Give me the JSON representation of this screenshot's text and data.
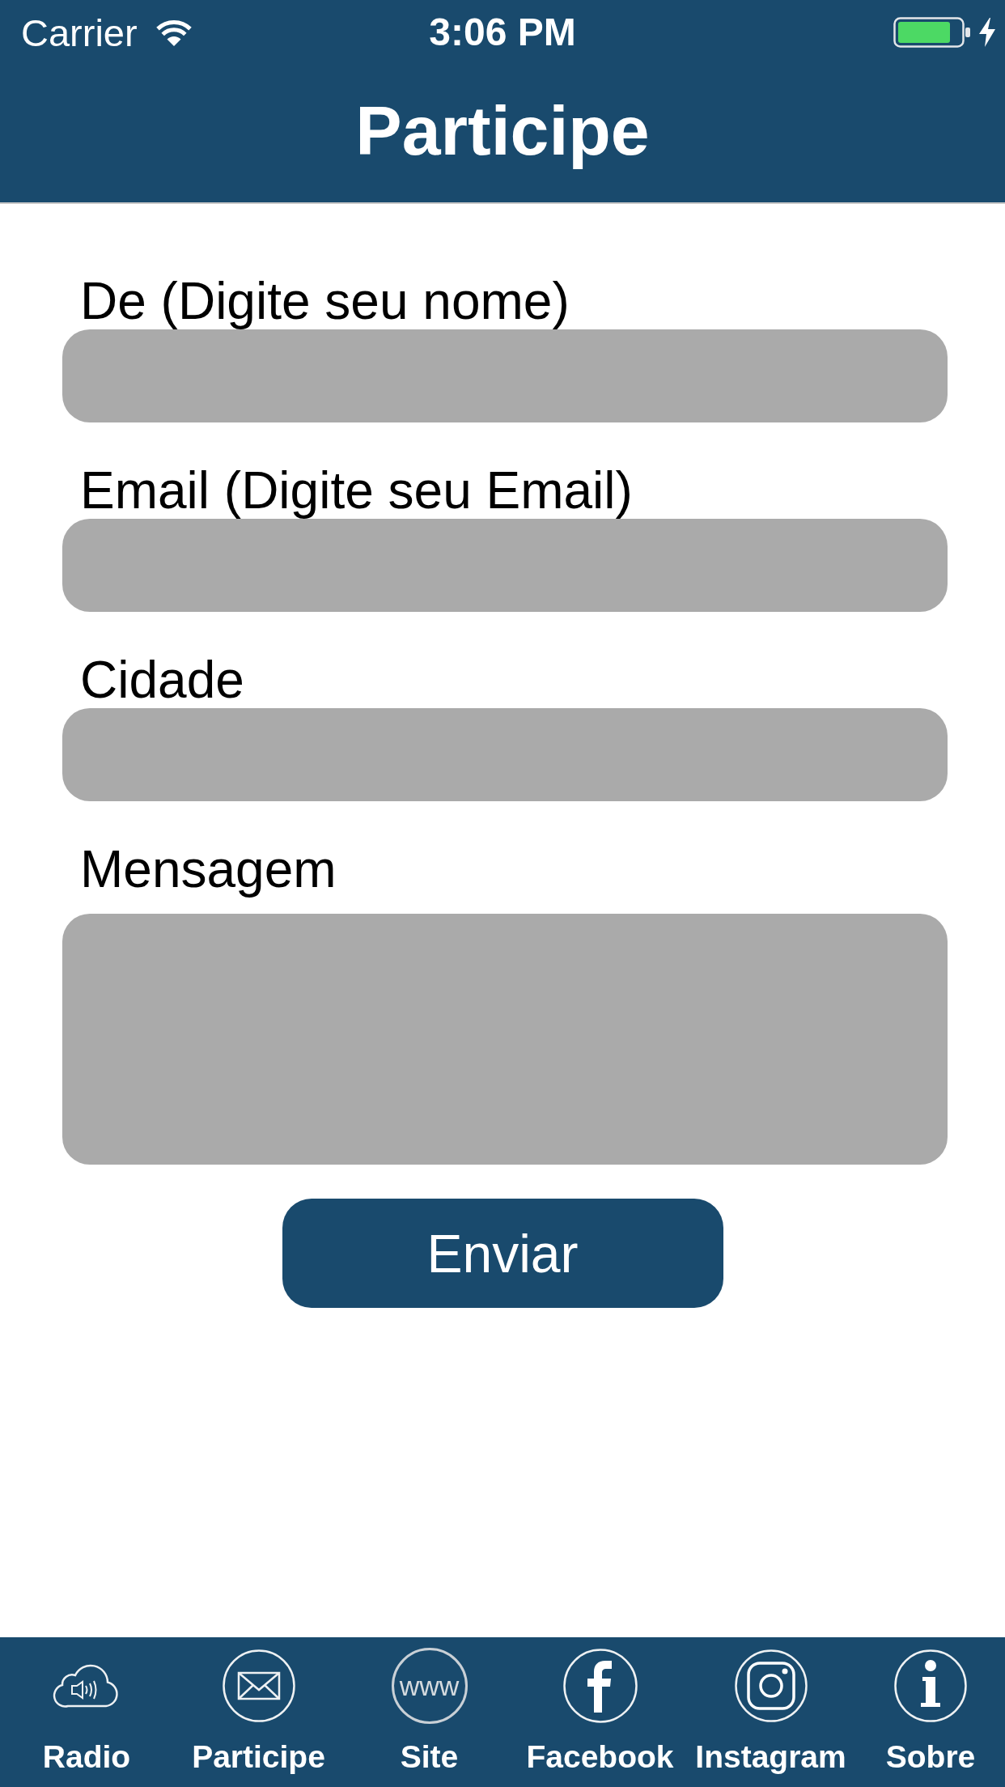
{
  "status_bar": {
    "carrier": "Carrier",
    "time": "3:06 PM",
    "charging": true
  },
  "nav_bar": {
    "title": "Participe"
  },
  "form": {
    "fields": [
      {
        "kind": "text",
        "label": "De (Digite seu nome)"
      },
      {
        "kind": "text",
        "label": "Email (Digite seu Email)"
      },
      {
        "kind": "text",
        "label": "Cidade"
      },
      {
        "kind": "multiline",
        "label": "Mensagem"
      }
    ],
    "submit_button": "Enviar"
  },
  "tab_bar": {
    "items": [
      {
        "label": "Radio"
      },
      {
        "label": "Participe"
      },
      {
        "label": "Site",
        "icon_text": "www"
      },
      {
        "label": "Facebook"
      },
      {
        "label": "Instagram"
      },
      {
        "label": "Sobre"
      }
    ]
  }
}
